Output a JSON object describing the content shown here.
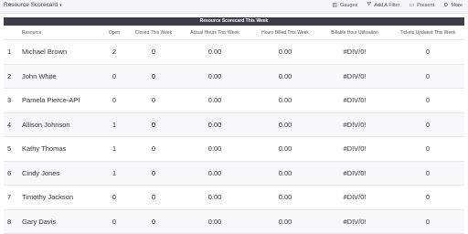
{
  "page": {
    "title": "Resource Scorecard",
    "toolbar": [
      {
        "label": "Gauges",
        "icon": "bar-chart-icon"
      },
      {
        "label": "Add A Filter",
        "icon": "filter-icon"
      },
      {
        "label": "Present",
        "icon": "present-icon"
      },
      {
        "label": "More",
        "icon": "gear-icon"
      }
    ]
  },
  "table": {
    "band_title": "Resource Scorecard This Week",
    "columns": [
      "Resource",
      "Open",
      "Closed This Week",
      "Actual Hours This Week",
      "Hours Billed This Week",
      "Billable Hour Utilization",
      "Tickets Updated This Week"
    ],
    "rows": [
      {
        "idx": "1",
        "name": "Michael Brown",
        "open": "2",
        "closed": "0",
        "actual": "0.00",
        "billed": "0.00",
        "util": "#DIV/0!",
        "tickets": "0"
      },
      {
        "idx": "2",
        "name": "John White",
        "open": "0",
        "closed": "0",
        "actual": "0.00",
        "billed": "0.00",
        "util": "#DIV/0!",
        "tickets": "0"
      },
      {
        "idx": "3",
        "name": "Pamela Pierce-API",
        "open": "0",
        "closed": "0",
        "actual": "0.00",
        "billed": "0.00",
        "util": "#DIV/0!",
        "tickets": "0"
      },
      {
        "idx": "4",
        "name": "Allison Johnson",
        "open": "1",
        "closed": "0",
        "actual": "0.00",
        "billed": "0.00",
        "util": "#DIV/0!",
        "tickets": "0"
      },
      {
        "idx": "5",
        "name": "Kathy Thomas",
        "open": "1",
        "closed": "0",
        "actual": "0.00",
        "billed": "0.00",
        "util": "#DIV/0!",
        "tickets": "0"
      },
      {
        "idx": "6",
        "name": "Cindy Jones",
        "open": "1",
        "closed": "0",
        "actual": "0.00",
        "billed": "0.00",
        "util": "#DIV/0!",
        "tickets": "0"
      },
      {
        "idx": "7",
        "name": "Timothy Jackson",
        "open": "0",
        "closed": "0",
        "actual": "0.00",
        "billed": "0.00",
        "util": "#DIV/0!",
        "tickets": "0"
      },
      {
        "idx": "8",
        "name": "Gary Davis",
        "open": "0",
        "closed": "0",
        "actual": "0.00",
        "billed": "0.00",
        "util": "#DIV/0!",
        "tickets": "0"
      }
    ]
  }
}
